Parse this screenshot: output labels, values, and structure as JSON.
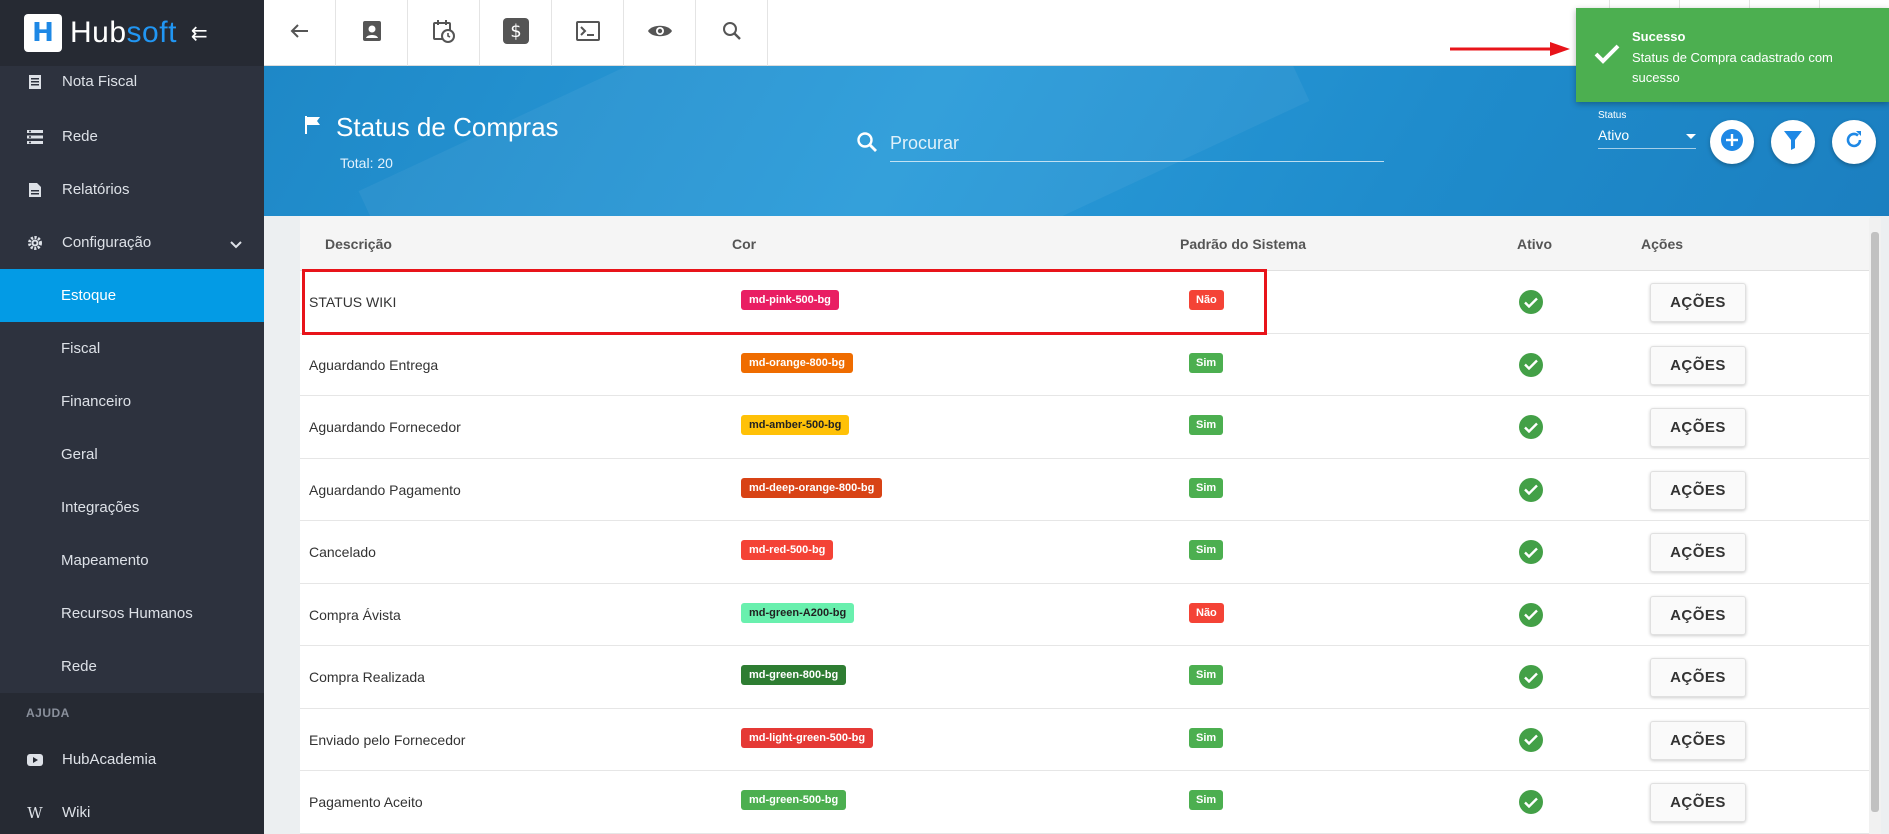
{
  "brand": {
    "name_a": "Hub",
    "name_b": "soft",
    "logo_letter": "H"
  },
  "sidebar": {
    "items": [
      {
        "label": "Nota Fiscal",
        "icon": "document-icon"
      },
      {
        "label": "Rede",
        "icon": "network-icon"
      },
      {
        "label": "Relatórios",
        "icon": "report-icon"
      },
      {
        "label": "Configuração",
        "icon": "gear-icon"
      }
    ],
    "sub_items": [
      {
        "label": "Estoque",
        "active": true
      },
      {
        "label": "Fiscal"
      },
      {
        "label": "Financeiro"
      },
      {
        "label": "Geral"
      },
      {
        "label": "Integrações"
      },
      {
        "label": "Mapeamento"
      },
      {
        "label": "Recursos Humanos"
      },
      {
        "label": "Rede"
      }
    ],
    "section_label": "AJUDA",
    "help_items": [
      {
        "label": "HubAcademia",
        "icon": "youtube-icon"
      },
      {
        "label": "Wiki",
        "icon": "wikipedia-icon"
      }
    ]
  },
  "topbar": {
    "icons": [
      "back-arrow-icon",
      "contact-card-icon",
      "calendar-clock-icon",
      "dollar-icon",
      "terminal-icon",
      "eye-icon",
      "search-icon"
    ]
  },
  "header": {
    "title": "Status de Compras",
    "total": "Total: 20",
    "search_placeholder": "Procurar",
    "status_label": "Status",
    "status_value": "Ativo"
  },
  "table": {
    "columns": [
      "Descrição",
      "Cor",
      "Padrão do Sistema",
      "Ativo",
      "Ações"
    ],
    "rows": [
      {
        "desc": "STATUS WIKI",
        "cor": "md-pink-500-bg",
        "cor_bg": "#e91e63",
        "cor_fg": "#ffffff",
        "padrao": "Não",
        "padrao_bg": "#f44336"
      },
      {
        "desc": "Aguardando Entrega",
        "cor": "md-orange-800-bg",
        "cor_bg": "#ef6c00",
        "cor_fg": "#ffffff",
        "padrao": "Sim",
        "padrao_bg": "#4caf50"
      },
      {
        "desc": "Aguardando Fornecedor",
        "cor": "md-amber-500-bg",
        "cor_bg": "#ffc107",
        "cor_fg": "#222222",
        "padrao": "Sim",
        "padrao_bg": "#4caf50"
      },
      {
        "desc": "Aguardando Pagamento",
        "cor": "md-deep-orange-800-bg",
        "cor_bg": "#d84315",
        "cor_fg": "#ffffff",
        "padrao": "Sim",
        "padrao_bg": "#4caf50"
      },
      {
        "desc": "Cancelado",
        "cor": "md-red-500-bg",
        "cor_bg": "#f44336",
        "cor_fg": "#ffffff",
        "padrao": "Sim",
        "padrao_bg": "#4caf50"
      },
      {
        "desc": "Compra Ávista",
        "cor": "md-green-A200-bg",
        "cor_bg": "#69f0ae",
        "cor_fg": "#222222",
        "padrao": "Não",
        "padrao_bg": "#f44336"
      },
      {
        "desc": "Compra Realizada",
        "cor": "md-green-800-bg",
        "cor_bg": "#2e7d32",
        "cor_fg": "#ffffff",
        "padrao": "Sim",
        "padrao_bg": "#4caf50"
      },
      {
        "desc": "Enviado pelo Fornecedor",
        "cor": "md-light-green-500-bg",
        "cor_bg": "#e53935",
        "cor_fg": "#ffffff",
        "padrao": "Sim",
        "padrao_bg": "#4caf50"
      },
      {
        "desc": "Pagamento Aceito",
        "cor": "md-green-500-bg",
        "cor_bg": "#4caf50",
        "cor_fg": "#ffffff",
        "padrao": "Sim",
        "padrao_bg": "#4caf50"
      }
    ],
    "action_label": "AÇÕES"
  },
  "toast": {
    "title": "Sucesso",
    "message": "Status de Compra cadastrado com sucesso",
    "color": "#4caf50"
  },
  "colors": {
    "sidebar_bg": "#2d323e",
    "active_item": "#039be5",
    "header_bg": "#2a9bd9",
    "highlight": "#e8141a"
  }
}
